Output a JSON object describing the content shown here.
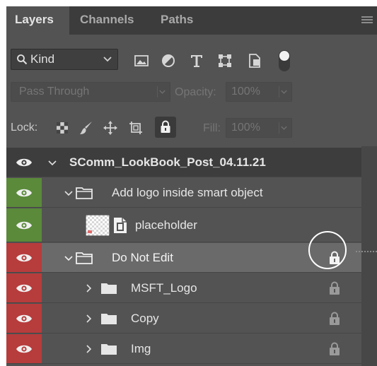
{
  "tabs": [
    {
      "label": "Layers",
      "active": true
    },
    {
      "label": "Channels",
      "active": false
    },
    {
      "label": "Paths",
      "active": false
    }
  ],
  "filter": {
    "kind_label": "Kind",
    "icons": [
      "image-filter-icon",
      "adjustment-filter-icon",
      "type-filter-icon",
      "shape-filter-icon",
      "smart-object-filter-icon",
      "filter-toggle-icon"
    ]
  },
  "blend": {
    "mode": "Pass Through",
    "opacity_label": "Opacity:",
    "opacity_value": "100%"
  },
  "lock": {
    "label": "Lock:",
    "fill_label": "Fill:",
    "fill_value": "100%"
  },
  "layers": [
    {
      "name": "SComm_LookBook_Post_04.11.21",
      "type": "artboard",
      "visibility_color": "",
      "locked": false
    },
    {
      "name": "Add logo inside smart object",
      "type": "group",
      "visibility_color": "#5a8a3a",
      "locked": false
    },
    {
      "name": "placeholder",
      "type": "smart-object",
      "visibility_color": "#5a8a3a",
      "locked": false
    },
    {
      "name": "Do Not Edit",
      "type": "group",
      "visibility_color": "#b73c3c",
      "locked": true
    },
    {
      "name": "MSFT_Logo",
      "type": "group",
      "visibility_color": "#b73c3c",
      "locked": true
    },
    {
      "name": "Copy",
      "type": "group",
      "visibility_color": "#b73c3c",
      "locked": true
    },
    {
      "name": "Img",
      "type": "group",
      "visibility_color": "#b73c3c",
      "locked": true
    }
  ],
  "colors": {
    "panel": "#535353",
    "tabbar": "#3c3c3c",
    "visibility_green": "#5a8a3a",
    "visibility_red": "#b73c3c",
    "selected_row": "#6a6a6a"
  }
}
